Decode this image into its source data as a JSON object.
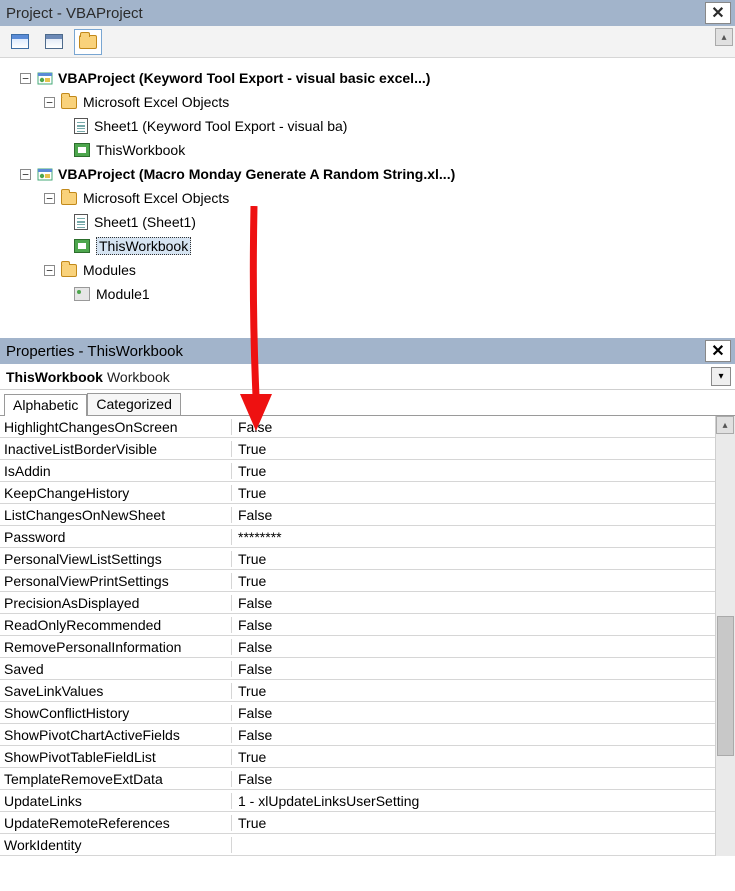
{
  "project_pane": {
    "title": "Project - VBAProject",
    "toolbar_icons": [
      "view-code-icon",
      "view-object-icon",
      "toggle-folders-icon"
    ]
  },
  "tree": [
    {
      "id": "p1",
      "indent": "indent-14",
      "bold": true,
      "expander": "−",
      "icon": "vbaproj",
      "label": "VBAProject (Keyword Tool Export - visual basic excel...)"
    },
    {
      "id": "p1f",
      "indent": "indent-38",
      "bold": false,
      "expander": "−",
      "icon": "folder",
      "label": "Microsoft Excel Objects"
    },
    {
      "id": "p1s",
      "indent": "indent-68",
      "bold": false,
      "expander": "",
      "icon": "sheet",
      "label": "Sheet1 (Keyword Tool Export - visual ba)"
    },
    {
      "id": "p1w",
      "indent": "indent-68",
      "bold": false,
      "expander": "",
      "icon": "wb",
      "label": "ThisWorkbook"
    },
    {
      "id": "p2",
      "indent": "indent-14",
      "bold": true,
      "expander": "−",
      "icon": "vbaproj",
      "label": "VBAProject (Macro Monday Generate A Random String.xl...)"
    },
    {
      "id": "p2f",
      "indent": "indent-38",
      "bold": false,
      "expander": "−",
      "icon": "folder",
      "label": "Microsoft Excel Objects"
    },
    {
      "id": "p2s",
      "indent": "indent-68",
      "bold": false,
      "expander": "",
      "icon": "sheet",
      "label": "Sheet1 (Sheet1)"
    },
    {
      "id": "p2w",
      "indent": "indent-68",
      "bold": false,
      "expander": "",
      "icon": "wb",
      "label": "ThisWorkbook",
      "selected": true
    },
    {
      "id": "p2m",
      "indent": "indent-38",
      "bold": false,
      "expander": "−",
      "icon": "folder",
      "label": "Modules"
    },
    {
      "id": "mod1",
      "indent": "indent-68",
      "bold": false,
      "expander": "",
      "icon": "mod",
      "label": "Module1"
    }
  ],
  "properties_pane": {
    "title": "Properties - ThisWorkbook",
    "object_name": "ThisWorkbook",
    "object_type": "Workbook",
    "tabs": {
      "alphabetic": "Alphabetic",
      "categorized": "Categorized",
      "active": "alphabetic"
    }
  },
  "properties": [
    {
      "name": "HighlightChangesOnScreen",
      "value": "False"
    },
    {
      "name": "InactiveListBorderVisible",
      "value": "True"
    },
    {
      "name": "IsAddin",
      "value": "True"
    },
    {
      "name": "KeepChangeHistory",
      "value": "True"
    },
    {
      "name": "ListChangesOnNewSheet",
      "value": "False"
    },
    {
      "name": "Password",
      "value": "********"
    },
    {
      "name": "PersonalViewListSettings",
      "value": "True"
    },
    {
      "name": "PersonalViewPrintSettings",
      "value": "True"
    },
    {
      "name": "PrecisionAsDisplayed",
      "value": "False"
    },
    {
      "name": "ReadOnlyRecommended",
      "value": "False"
    },
    {
      "name": "RemovePersonalInformation",
      "value": "False"
    },
    {
      "name": "Saved",
      "value": "False"
    },
    {
      "name": "SaveLinkValues",
      "value": "True"
    },
    {
      "name": "ShowConflictHistory",
      "value": "False"
    },
    {
      "name": "ShowPivotChartActiveFields",
      "value": "False"
    },
    {
      "name": "ShowPivotTableFieldList",
      "value": "True"
    },
    {
      "name": "TemplateRemoveExtData",
      "value": "False"
    },
    {
      "name": "UpdateLinks",
      "value": "1 - xlUpdateLinksUserSetting"
    },
    {
      "name": "UpdateRemoteReferences",
      "value": "True"
    },
    {
      "name": "WorkIdentity",
      "value": ""
    }
  ]
}
